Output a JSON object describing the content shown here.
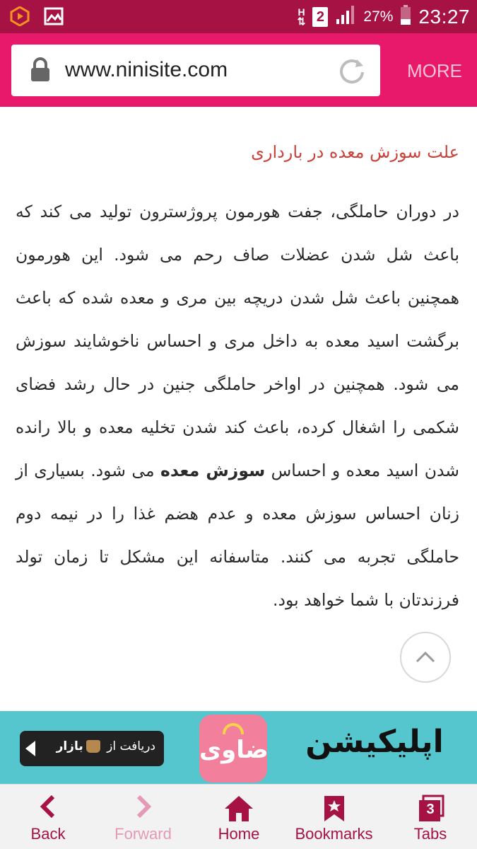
{
  "status_bar": {
    "network_type": "H",
    "sim_slot": "2",
    "battery_percent": "27%",
    "time": "23:27",
    "icons": [
      "app-notification-icon",
      "image-notification-icon",
      "signal-icon",
      "battery-icon"
    ]
  },
  "toolbar": {
    "url": "www.ninisite.com",
    "more_label": "MORE",
    "lock_icon": "lock-icon",
    "reload_icon": "reload-icon"
  },
  "article": {
    "heading": "علت سوزش معده در بارداری",
    "text_before_bold": "در دوران حاملگی، جفت هورمون پروژسترون تولید می کند که باعث شل شدن عضلات صاف رحم می شود. این هورمون همچنین باعث شل شدن دریچه بین مری و معده شده که باعث برگشت اسید معده به داخل مری و احساس ناخوشایند سوزش می شود. همچنین در اواخر حاملگی جنین در حال رشد فضای شکمی را اشغال کرده، باعث کند شدن تخلیه معده و بالا رانده شدن اسید معده و احساس ",
    "bold_term": "سوزش معده",
    "text_after_bold": " می شود. بسیاری از زنان احساس سوزش معده و عدم هضم غذا را در نیمه دوم حاملگی تجربه می کنند. متاسفانه این مشکل تا زمان تولد فرزندتان با شما خواهد بود."
  },
  "banner": {
    "download_label": "دریافت از",
    "store_name": "بازار",
    "app_logo_text": "ضاوی",
    "app_word": "اپلیکیشن",
    "accent_color": "#55c6cd"
  },
  "bottom_nav": {
    "back": "Back",
    "forward": "Forward",
    "home": "Home",
    "bookmarks": "Bookmarks",
    "tabs": "Tabs",
    "tab_count": "3"
  },
  "colors": {
    "status_bar": "#a51243",
    "toolbar": "#e8196a",
    "heading": "#c9423b",
    "nav_active": "#a51243",
    "nav_disabled": "#e39ab6"
  }
}
